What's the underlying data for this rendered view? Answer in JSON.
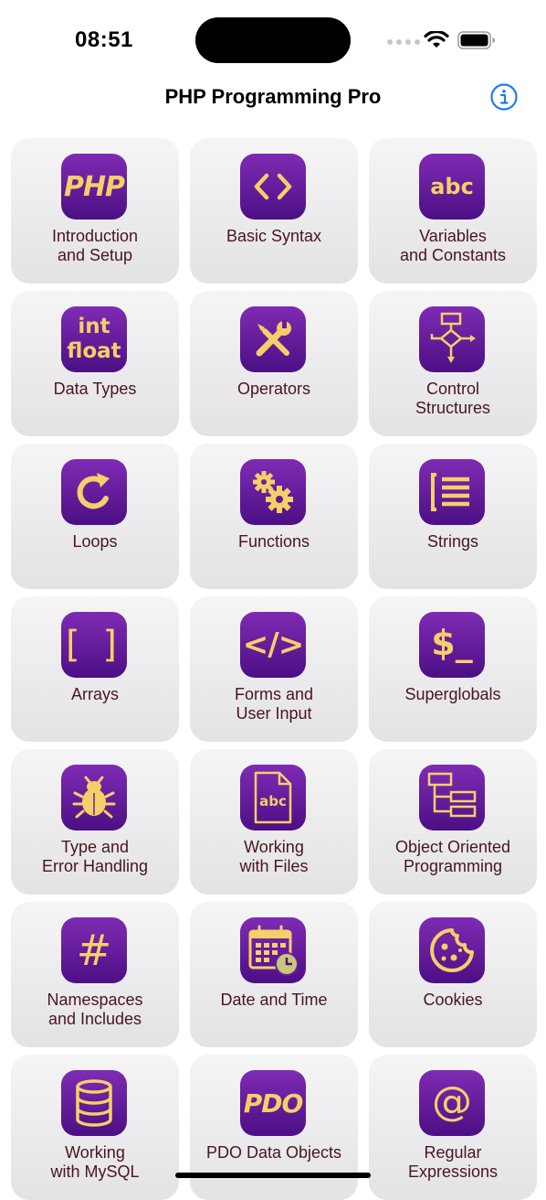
{
  "status_bar": {
    "time": "08:51"
  },
  "nav": {
    "title": "PHP Programming Pro",
    "info_icon": "info-circle-icon"
  },
  "colors": {
    "accent": "#1e7cf2",
    "icon_gradient_top": "#7f2bb4",
    "icon_gradient_bottom": "#4c0f84",
    "icon_glyph": "#f6cf68",
    "label": "#4a1420"
  },
  "topics": [
    {
      "label": "Introduction\nand Setup",
      "icon": "php-logo-icon",
      "icon_text": "PHP"
    },
    {
      "label": "Basic Syntax",
      "icon": "angle-brackets-icon"
    },
    {
      "label": "Variables\nand Constants",
      "icon": "abc-text-icon",
      "icon_text": "abc"
    },
    {
      "label": "Data Types",
      "icon": "int-float-icon",
      "icon_text": "int\nfloat"
    },
    {
      "label": "Operators",
      "icon": "wrench-screwdriver-icon"
    },
    {
      "label": "Control\nStructures",
      "icon": "flowchart-icon"
    },
    {
      "label": "Loops",
      "icon": "refresh-arrow-icon"
    },
    {
      "label": "Functions",
      "icon": "gears-icon"
    },
    {
      "label": "Strings",
      "icon": "text-lines-icon"
    },
    {
      "label": "Arrays",
      "icon": "square-brackets-icon",
      "icon_text": "[ ]"
    },
    {
      "label": "Forms and\nUser Input",
      "icon": "code-tag-icon",
      "icon_text": "</>"
    },
    {
      "label": "Superglobals",
      "icon": "dollar-prompt-icon",
      "icon_text": "$_"
    },
    {
      "label": "Type and\nError Handling",
      "icon": "bug-icon"
    },
    {
      "label": "Working\nwith Files",
      "icon": "file-abc-icon",
      "icon_text": "abc"
    },
    {
      "label": "Object Oriented\nProgramming",
      "icon": "class-hierarchy-icon"
    },
    {
      "label": "Namespaces\nand Includes",
      "icon": "hash-icon",
      "icon_text": "#"
    },
    {
      "label": "Date and Time",
      "icon": "calendar-clock-icon"
    },
    {
      "label": "Cookies",
      "icon": "cookie-icon"
    },
    {
      "label": "Working\nwith MySQL",
      "icon": "database-icon"
    },
    {
      "label": "PDO Data Objects",
      "icon": "pdo-logo-icon",
      "icon_text": "PDO"
    },
    {
      "label": "Regular\nExpressions",
      "icon": "at-sign-icon",
      "icon_text": "@"
    }
  ]
}
